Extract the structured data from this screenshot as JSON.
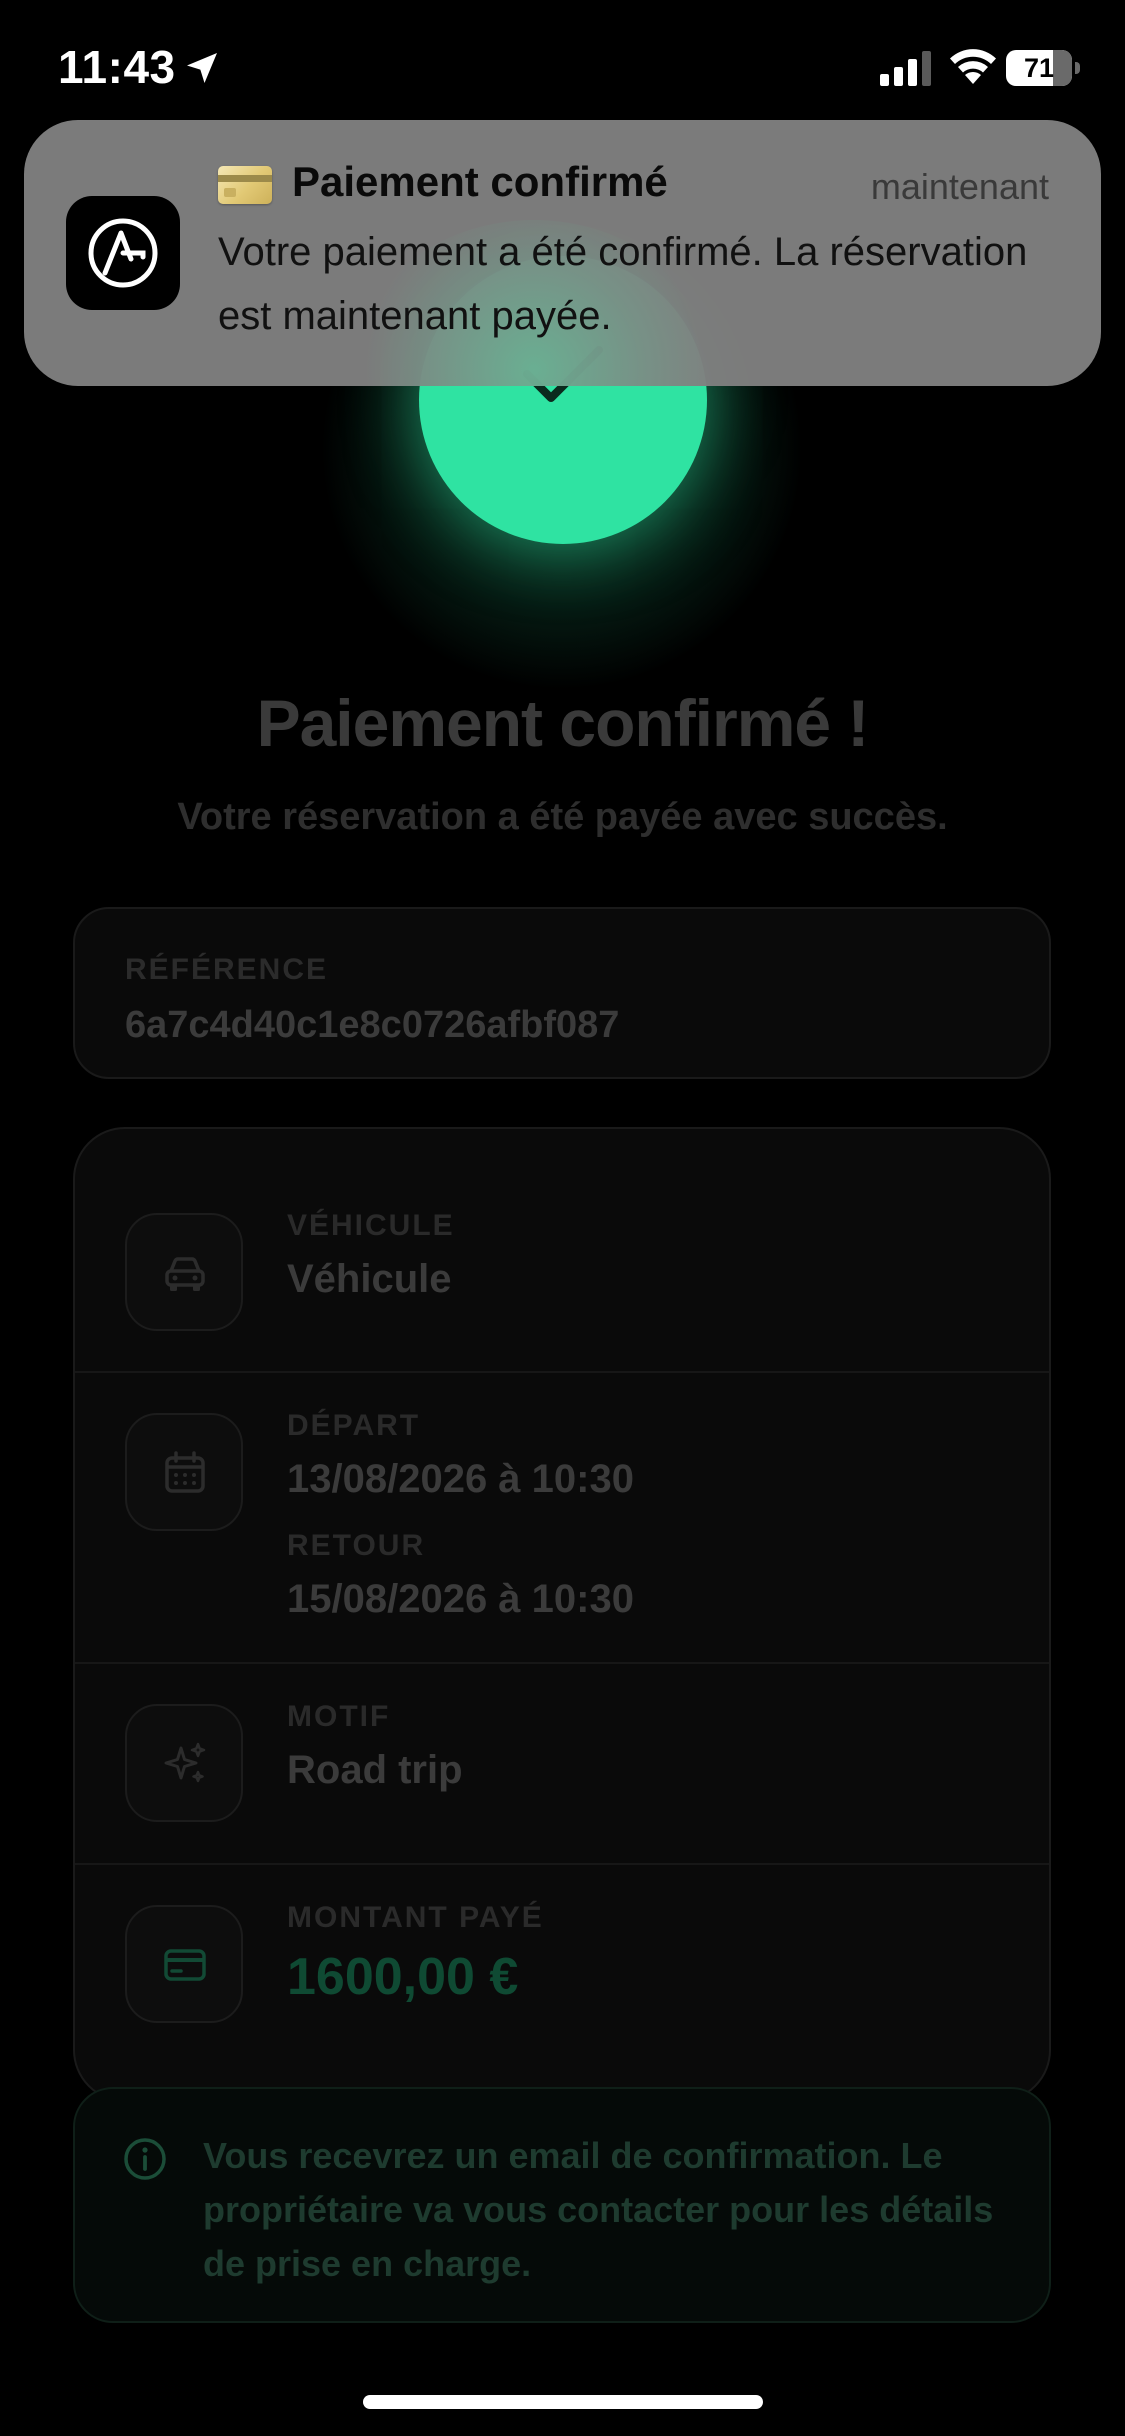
{
  "status_bar": {
    "time": "11:43",
    "battery_level": "71",
    "battery_fraction": 0.71
  },
  "notification": {
    "app_icon": "app-logo-icon",
    "emoji": "credit-card-emoji",
    "title": "Paiement confirmé",
    "time": "maintenant",
    "body": "Votre paiement a été confirmé. La réservation est maintenant payée."
  },
  "header": {
    "success_icon": "checkmark-icon",
    "title": "Paiement confirmé !",
    "subtitle": "Votre réservation a été payée avec succès."
  },
  "reference": {
    "label": "RÉFÉRENCE",
    "value": "6a7c4d40c1e8c0726afbf087"
  },
  "details": {
    "vehicle": {
      "icon": "car-icon",
      "label": "VÉHICULE",
      "value": "Véhicule"
    },
    "dates": {
      "icon": "calendar-icon",
      "departure_label": "DÉPART",
      "departure_value": "13/08/2026 à 10:30",
      "return_label": "RETOUR",
      "return_value": "15/08/2026 à 10:30"
    },
    "reason": {
      "icon": "sparkles-icon",
      "label": "MOTIF",
      "value": "Road trip"
    },
    "amount": {
      "icon": "credit-card-icon",
      "label": "MONTANT PAYÉ",
      "value": "1600,00 €"
    }
  },
  "info": {
    "icon": "info-icon",
    "text": "Vous recevrez un email de confirmation. Le propriétaire va vous contacter pour les détails de prise en charge."
  },
  "colors": {
    "accent": "#2fe3a2",
    "background": "#000000",
    "amount": "#0f4a33"
  }
}
